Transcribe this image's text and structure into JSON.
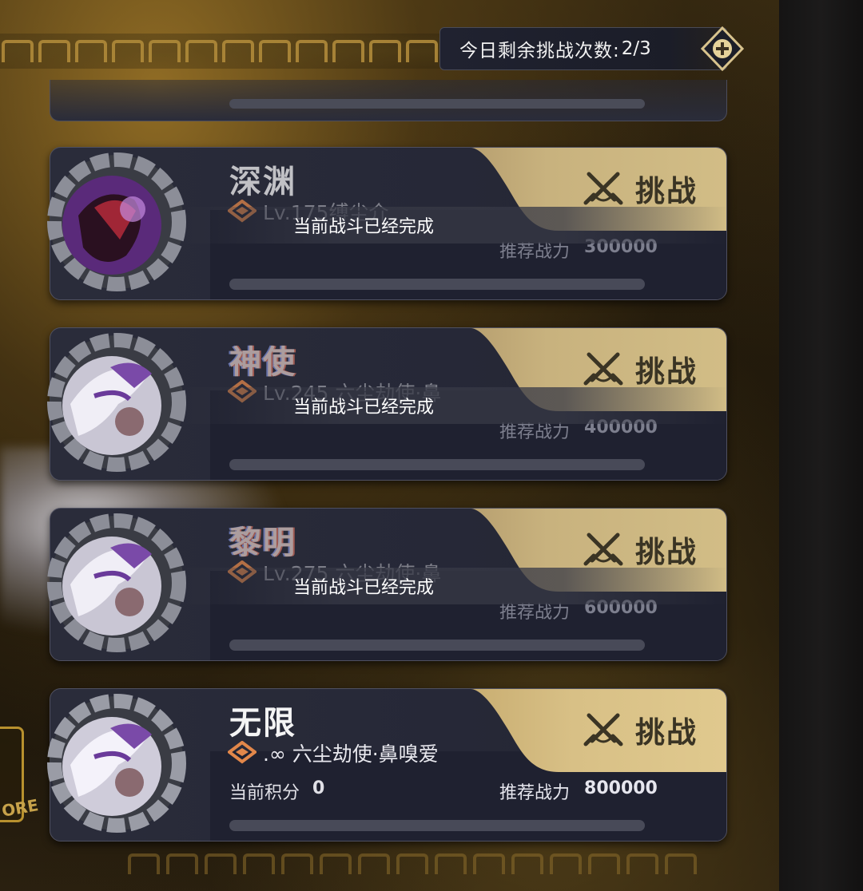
{
  "header": {
    "remaining_label": "今日剩余挑战次数:",
    "remaining_value": "2/3"
  },
  "cards": [
    {
      "title": "深渊",
      "level": "Lv.175缚尘介",
      "power_label": "推荐战力",
      "power": "300000",
      "challenge_label": "挑战",
      "status": "当前战斗已经完成",
      "avatar": "purple-demon-portrait"
    },
    {
      "title": "神使",
      "level": "Lv.245 六尘劫使·鼻",
      "power_label": "推荐战力",
      "power": "400000",
      "challenge_label": "挑战",
      "status": "当前战斗已经完成",
      "avatar": "masked-fox-portrait"
    },
    {
      "title": "黎明",
      "level": "Lv.275 六尘劫使·鼻",
      "power_label": "推荐战力",
      "power": "600000",
      "challenge_label": "挑战",
      "status": "当前战斗已经完成",
      "avatar": "masked-fox-portrait"
    },
    {
      "title": "无限",
      "level": ".∞ 六尘劫使·鼻嗅爱",
      "score_label": "当前积分",
      "score": "0",
      "power_label": "推荐战力",
      "power": "800000",
      "challenge_label": "挑战",
      "avatar": "masked-fox-portrait"
    }
  ],
  "emblem_text": "ORE"
}
